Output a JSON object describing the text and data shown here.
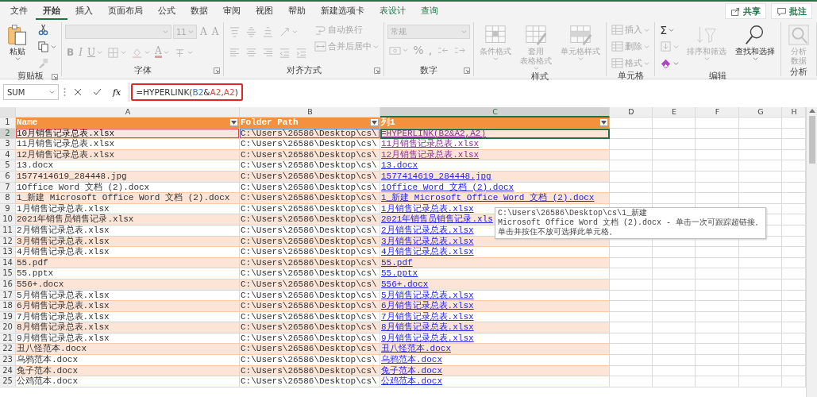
{
  "ribbon_tabs": [
    {
      "label": "文件",
      "selected": false,
      "contextual": false
    },
    {
      "label": "开始",
      "selected": true,
      "contextual": false
    },
    {
      "label": "插入",
      "selected": false,
      "contextual": false
    },
    {
      "label": "页面布局",
      "selected": false,
      "contextual": false
    },
    {
      "label": "公式",
      "selected": false,
      "contextual": false
    },
    {
      "label": "数据",
      "selected": false,
      "contextual": false
    },
    {
      "label": "审阅",
      "selected": false,
      "contextual": false
    },
    {
      "label": "视图",
      "selected": false,
      "contextual": false
    },
    {
      "label": "帮助",
      "selected": false,
      "contextual": false
    },
    {
      "label": "新建选项卡",
      "selected": false,
      "contextual": false
    },
    {
      "label": "表设计",
      "selected": false,
      "contextual": true
    },
    {
      "label": "查询",
      "selected": false,
      "contextual": true
    }
  ],
  "header_buttons": [
    {
      "kind": "share",
      "label": "共享"
    },
    {
      "kind": "comment",
      "label": "批注"
    }
  ],
  "ribbon_groups": [
    {
      "label": "剪贴板",
      "launcher": true,
      "columns": [
        [
          {
            "kind": "paste",
            "label": "粘贴",
            "dropdown": true,
            "disabled": false
          }
        ],
        [
          {
            "kind": "cut",
            "disabled": false
          },
          {
            "kind": "copy",
            "dropdown": true,
            "disabled": false
          },
          {
            "kind": "painter",
            "disabled": true
          }
        ]
      ]
    },
    {
      "label": "字体",
      "launcher": true,
      "columns": [
        [
          {
            "kind": "row",
            "items": [
              {
                "kind": "font_name",
                "disabled": true
              },
              {
                "kind": "font_size",
                "value": "11",
                "disabled": true
              },
              {
                "kind": "grow",
                "glyph": "A",
                "disabled": true
              },
              {
                "kind": "shrink",
                "glyph": "A",
                "disabled": true
              }
            ]
          },
          {
            "kind": "row",
            "items": [
              {
                "kind": "bold",
                "glyph": "B",
                "disabled": true
              },
              {
                "kind": "italic",
                "glyph": "I",
                "disabled": true
              },
              {
                "kind": "underline",
                "glyph": "U",
                "dropdown": true,
                "disabled": true
              },
              {
                "kind": "borders",
                "dropdown": true,
                "disabled": true
              },
              {
                "kind": "fill_color",
                "dropdown": true,
                "disabled": true
              },
              {
                "kind": "font_color",
                "glyph": "A",
                "dropdown": true,
                "disabled": true
              },
              {
                "kind": "phonetic",
                "dropdown": true,
                "disabled": true
              }
            ]
          }
        ]
      ]
    },
    {
      "label": "对齐方式",
      "launcher": true,
      "columns": [
        [
          {
            "kind": "row",
            "items": [
              {
                "kind": "align_top",
                "disabled": true
              },
              {
                "kind": "align_middle",
                "disabled": true
              },
              {
                "kind": "align_bottom",
                "disabled": true
              },
              {
                "kind": "orientation",
                "dropdown": true,
                "disabled": true
              }
            ]
          },
          {
            "kind": "row",
            "items": [
              {
                "kind": "align_left",
                "disabled": true
              },
              {
                "kind": "align_center",
                "disabled": true
              },
              {
                "kind": "align_right",
                "disabled": true
              },
              {
                "kind": "outdent",
                "disabled": true
              },
              {
                "kind": "indent",
                "disabled": true
              }
            ]
          }
        ],
        [
          {
            "kind": "wrap",
            "label": "自动换行",
            "disabled": true
          },
          {
            "kind": "merge",
            "label": "合并后居中",
            "dropdown": true,
            "disabled": true
          }
        ]
      ]
    },
    {
      "label": "数字",
      "launcher": true,
      "columns": [
        [
          {
            "kind": "number_format",
            "value": "常规",
            "disabled": true
          },
          {
            "kind": "row",
            "items": [
              {
                "kind": "accounting",
                "dropdown": true,
                "disabled": true
              },
              {
                "kind": "percent",
                "glyph": "%",
                "disabled": true
              },
              {
                "kind": "comma",
                "glyph": ",",
                "disabled": true
              },
              {
                "kind": "inc_decimal",
                "disabled": true
              },
              {
                "kind": "dec_decimal",
                "disabled": true
              }
            ]
          }
        ]
      ]
    },
    {
      "label": "样式",
      "launcher": false,
      "columns": [
        [
          {
            "kind": "conditional",
            "label_lines": [
              "条件格式"
            ],
            "dropdown": true,
            "disabled": true
          }
        ],
        [
          {
            "kind": "table_format",
            "label_lines": [
              "套用",
              "表格格式"
            ],
            "dropdown": true,
            "disabled": true
          }
        ],
        [
          {
            "kind": "cell_styles",
            "label_lines": [
              "单元格样式"
            ],
            "dropdown": true,
            "disabled": true
          }
        ]
      ]
    },
    {
      "label": "单元格",
      "launcher": false,
      "columns": [
        [
          {
            "kind": "insert",
            "label": "插入",
            "dropdown": true,
            "disabled": true
          },
          {
            "kind": "delete",
            "label": "删除",
            "dropdown": true,
            "disabled": true
          },
          {
            "kind": "format",
            "label": "格式",
            "dropdown": true,
            "disabled": true
          }
        ]
      ]
    },
    {
      "label": "编辑",
      "launcher": false,
      "columns": [
        [
          {
            "kind": "autosum",
            "glyph": "Σ",
            "dropdown": true,
            "disabled": false
          },
          {
            "kind": "fill",
            "dropdown": true,
            "disabled": true
          },
          {
            "kind": "clear",
            "dropdown": true,
            "disabled": false
          }
        ],
        [
          {
            "kind": "sort",
            "label_lines": [
              "排序和筛选"
            ],
            "dropdown": true,
            "disabled": true
          }
        ],
        [
          {
            "kind": "find",
            "label_lines": [
              "查找和选择"
            ],
            "dropdown": true,
            "disabled": false
          }
        ]
      ]
    },
    {
      "label": "分析",
      "launcher": false,
      "columns": [
        [
          {
            "kind": "analyze",
            "label_lines": [
              "分析",
              "数据"
            ],
            "disabled": true
          }
        ]
      ]
    }
  ],
  "formula_bar": {
    "name_box": "SUM",
    "fx": "fx",
    "highlighted": true,
    "parts": [
      {
        "text": "=HYPERLINK("
      },
      {
        "text": "B2",
        "color": "#4472c4"
      },
      {
        "text": "&"
      },
      {
        "text": "A2",
        "color": "#e0443e"
      },
      {
        "text": ","
      },
      {
        "text": "A2",
        "color": "#e0443e"
      },
      {
        "text": ")"
      }
    ]
  },
  "sheet": {
    "columns": [
      {
        "label": "A",
        "selected": false
      },
      {
        "label": "B",
        "selected": false
      },
      {
        "label": "C",
        "selected": true
      },
      {
        "label": "D",
        "selected": false
      },
      {
        "label": "E",
        "selected": false
      },
      {
        "label": "F",
        "selected": false
      },
      {
        "label": "G",
        "selected": false
      },
      {
        "label": "H",
        "selected": false
      }
    ],
    "header_row": {
      "number": "1",
      "titles": [
        "Name",
        "Folder Path",
        "列1"
      ]
    },
    "rows": [
      {
        "number": "2",
        "selected": true,
        "referenced": true,
        "name": "10月销售记录总表.xlsx",
        "path": "C:\\Users\\26586\\Desktop\\cs\\",
        "link": "=HYPERLINK(B2&A2,A2)",
        "visited": true,
        "editing": true
      },
      {
        "number": "3",
        "selected": false,
        "referenced": false,
        "name": "11月销售记录总表.xlsx",
        "path": "C:\\Users\\26586\\Desktop\\cs\\",
        "link": "11月销售记录总表.xlsx",
        "visited": true,
        "editing": false
      },
      {
        "number": "4",
        "selected": false,
        "referenced": false,
        "name": "12月销售记录总表.xlsx",
        "path": "C:\\Users\\26586\\Desktop\\cs\\",
        "link": "12月销售记录总表.xlsx",
        "visited": true,
        "editing": false
      },
      {
        "number": "5",
        "selected": false,
        "referenced": false,
        "name": "13.docx",
        "path": "C:\\Users\\26586\\Desktop\\cs\\",
        "link": "13.docx",
        "visited": false,
        "editing": false
      },
      {
        "number": "6",
        "selected": false,
        "referenced": false,
        "name": "1577414619_284448.jpg",
        "path": "C:\\Users\\26586\\Desktop\\cs\\",
        "link": "1577414619_284448.jpg",
        "visited": false,
        "editing": false
      },
      {
        "number": "7",
        "selected": false,
        "referenced": false,
        "name": "1Office Word 文档 (2).docx",
        "path": "C:\\Users\\26586\\Desktop\\cs\\",
        "link": "1Office Word 文档 (2).docx",
        "visited": false,
        "editing": false
      },
      {
        "number": "8",
        "selected": false,
        "referenced": false,
        "name": "1_新建 Microsoft Office Word 文档 (2).docx",
        "path": "C:\\Users\\26586\\Desktop\\cs\\",
        "link": "1_新建 Microsoft Office Word 文档 (2).docx",
        "visited": false,
        "editing": false
      },
      {
        "number": "9",
        "selected": false,
        "referenced": false,
        "name": "1月销售记录总表.xlsx",
        "path": "C:\\Users\\26586\\Desktop\\cs\\",
        "link": "1月销售记录总表.xlsx",
        "visited": false,
        "editing": false
      },
      {
        "number": "10",
        "selected": false,
        "referenced": false,
        "name": "2021年销售员销售记录.xlsx",
        "path": "C:\\Users\\26586\\Desktop\\cs\\",
        "link": "2021年销售员销售记录.xls",
        "visited": false,
        "editing": false
      },
      {
        "number": "11",
        "selected": false,
        "referenced": false,
        "name": "2月销售记录总表.xlsx",
        "path": "C:\\Users\\26586\\Desktop\\cs\\",
        "link": "2月销售记录总表.xlsx",
        "visited": false,
        "editing": false
      },
      {
        "number": "12",
        "selected": false,
        "referenced": false,
        "name": "3月销售记录总表.xlsx",
        "path": "C:\\Users\\26586\\Desktop\\cs\\",
        "link": "3月销售记录总表.xlsx",
        "visited": false,
        "editing": false
      },
      {
        "number": "13",
        "selected": false,
        "referenced": false,
        "name": "4月销售记录总表.xlsx",
        "path": "C:\\Users\\26586\\Desktop\\cs\\",
        "link": "4月销售记录总表.xlsx",
        "visited": false,
        "editing": false
      },
      {
        "number": "14",
        "selected": false,
        "referenced": false,
        "name": "55.pdf",
        "path": "C:\\Users\\26586\\Desktop\\cs\\",
        "link": "55.pdf",
        "visited": false,
        "editing": false
      },
      {
        "number": "15",
        "selected": false,
        "referenced": false,
        "name": "55.pptx",
        "path": "C:\\Users\\26586\\Desktop\\cs\\",
        "link": "55.pptx",
        "visited": false,
        "editing": false
      },
      {
        "number": "16",
        "selected": false,
        "referenced": false,
        "name": "556+.docx",
        "path": "C:\\Users\\26586\\Desktop\\cs\\",
        "link": "556+.docx",
        "visited": false,
        "editing": false
      },
      {
        "number": "17",
        "selected": false,
        "referenced": false,
        "name": "5月销售记录总表.xlsx",
        "path": "C:\\Users\\26586\\Desktop\\cs\\",
        "link": "5月销售记录总表.xlsx",
        "visited": false,
        "editing": false
      },
      {
        "number": "18",
        "selected": false,
        "referenced": false,
        "name": "6月销售记录总表.xlsx",
        "path": "C:\\Users\\26586\\Desktop\\cs\\",
        "link": "6月销售记录总表.xlsx",
        "visited": false,
        "editing": false
      },
      {
        "number": "19",
        "selected": false,
        "referenced": false,
        "name": "7月销售记录总表.xlsx",
        "path": "C:\\Users\\26586\\Desktop\\cs\\",
        "link": "7月销售记录总表.xlsx",
        "visited": false,
        "editing": false
      },
      {
        "number": "20",
        "selected": false,
        "referenced": false,
        "name": "8月销售记录总表.xlsx",
        "path": "C:\\Users\\26586\\Desktop\\cs\\",
        "link": "8月销售记录总表.xlsx",
        "visited": false,
        "editing": false
      },
      {
        "number": "21",
        "selected": false,
        "referenced": false,
        "name": "9月销售记录总表.xlsx",
        "path": "C:\\Users\\26586\\Desktop\\cs\\",
        "link": "9月销售记录总表.xlsx",
        "visited": false,
        "editing": false
      },
      {
        "number": "22",
        "selected": false,
        "referenced": false,
        "name": "丑八怪范本.docx",
        "path": "C:\\Users\\26586\\Desktop\\cs\\",
        "link": "丑八怪范本.docx",
        "visited": false,
        "editing": false
      },
      {
        "number": "23",
        "selected": false,
        "referenced": false,
        "name": "乌鸦范本.docx",
        "path": "C:\\Users\\26586\\Desktop\\cs\\",
        "link": "乌鸦范本.docx",
        "visited": false,
        "editing": false
      },
      {
        "number": "24",
        "selected": false,
        "referenced": false,
        "name": "兔子范本.docx",
        "path": "C:\\Users\\26586\\Desktop\\cs\\",
        "link": "兔子范本.docx",
        "visited": false,
        "editing": false
      },
      {
        "number": "25",
        "selected": false,
        "referenced": false,
        "name": "公鸡范本.docx",
        "path": "C:\\Users\\26586\\Desktop\\cs\\",
        "link": "公鸡范本.docx",
        "visited": false,
        "editing": false
      }
    ],
    "tooltip": {
      "lines": [
        "C:\\Users\\26586\\Desktop\\cs\\1_新建",
        "Microsoft Office Word 文档 (2).docx - 单击一次可跟踪超链接。",
        "单击并按住不放可选择此单元格。"
      ]
    }
  }
}
